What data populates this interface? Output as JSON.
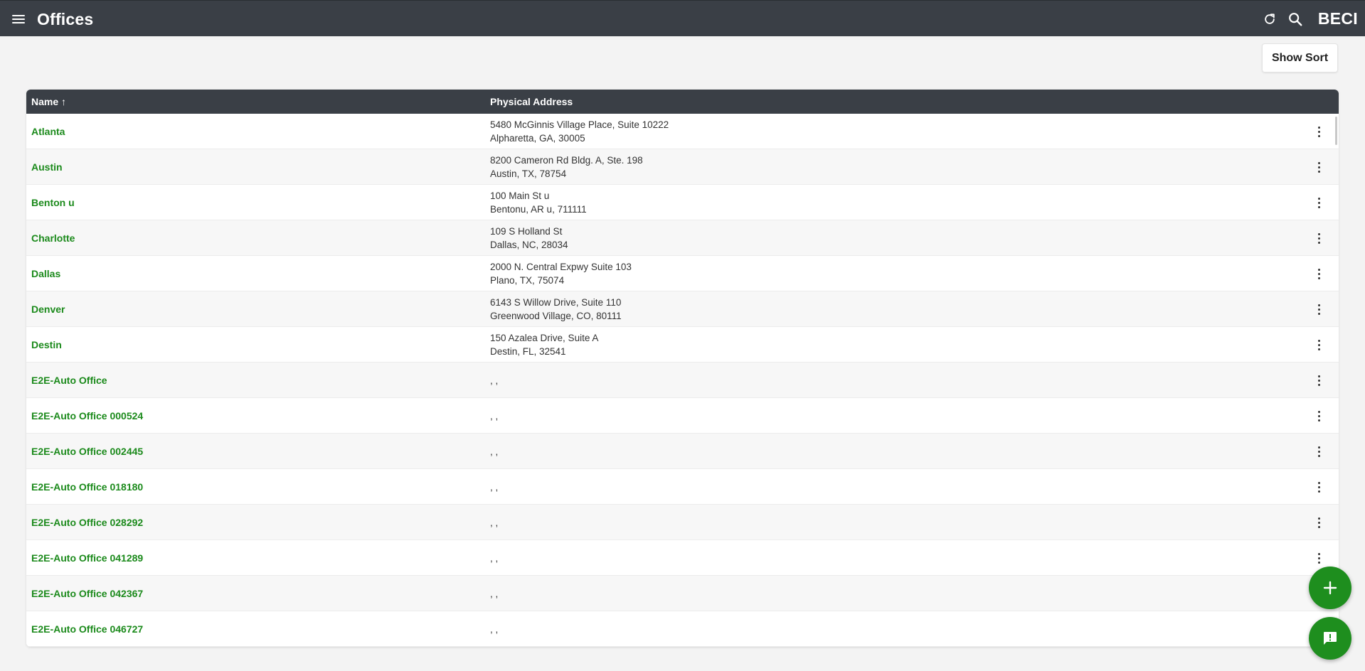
{
  "app": {
    "title": "Offices",
    "brand": "BECI"
  },
  "toolbar": {
    "show_sort_label": "Show Sort"
  },
  "table": {
    "columns": {
      "name": "Name ↑",
      "address": "Physical Address"
    },
    "rows": [
      {
        "name": "Atlanta",
        "line1": "5480 McGinnis Village Place, Suite 10222",
        "line2": "Alpharetta, GA, 30005"
      },
      {
        "name": "Austin",
        "line1": "8200 Cameron Rd Bldg. A, Ste. 198",
        "line2": "Austin, TX, 78754"
      },
      {
        "name": "Benton u",
        "line1": "100 Main St u",
        "line2": "Bentonu, AR u, 711111"
      },
      {
        "name": "Charlotte",
        "line1": "109 S Holland St",
        "line2": "Dallas, NC, 28034"
      },
      {
        "name": "Dallas",
        "line1": "2000 N. Central Expwy Suite 103",
        "line2": "Plano, TX, 75074"
      },
      {
        "name": "Denver",
        "line1": "6143 S Willow Drive, Suite 110",
        "line2": "Greenwood Village, CO, 80111"
      },
      {
        "name": "Destin",
        "line1": "150 Azalea Drive, Suite A",
        "line2": "Destin, FL, 32541"
      },
      {
        "name": "E2E-Auto Office",
        "line1": ", ,",
        "line2": ""
      },
      {
        "name": "E2E-Auto Office 000524",
        "line1": ", ,",
        "line2": ""
      },
      {
        "name": "E2E-Auto Office 002445",
        "line1": ", ,",
        "line2": ""
      },
      {
        "name": "E2E-Auto Office 018180",
        "line1": ", ,",
        "line2": ""
      },
      {
        "name": "E2E-Auto Office 028292",
        "line1": ", ,",
        "line2": ""
      },
      {
        "name": "E2E-Auto Office 041289",
        "line1": ", ,",
        "line2": ""
      },
      {
        "name": "E2E-Auto Office 042367",
        "line1": ", ,",
        "line2": ""
      },
      {
        "name": "E2E-Auto Office 046727",
        "line1": ", ,",
        "line2": ""
      }
    ]
  },
  "colors": {
    "header_bg": "#3a3f46",
    "link_green": "#1b8a1b",
    "fab_green": "#1e8e1e"
  },
  "icons": {
    "menu": "hamburger-icon",
    "refresh": "refresh-icon",
    "search": "search-icon",
    "row_actions": "more-vertical-icon",
    "add": "plus-icon",
    "feedback": "feedback-icon"
  }
}
